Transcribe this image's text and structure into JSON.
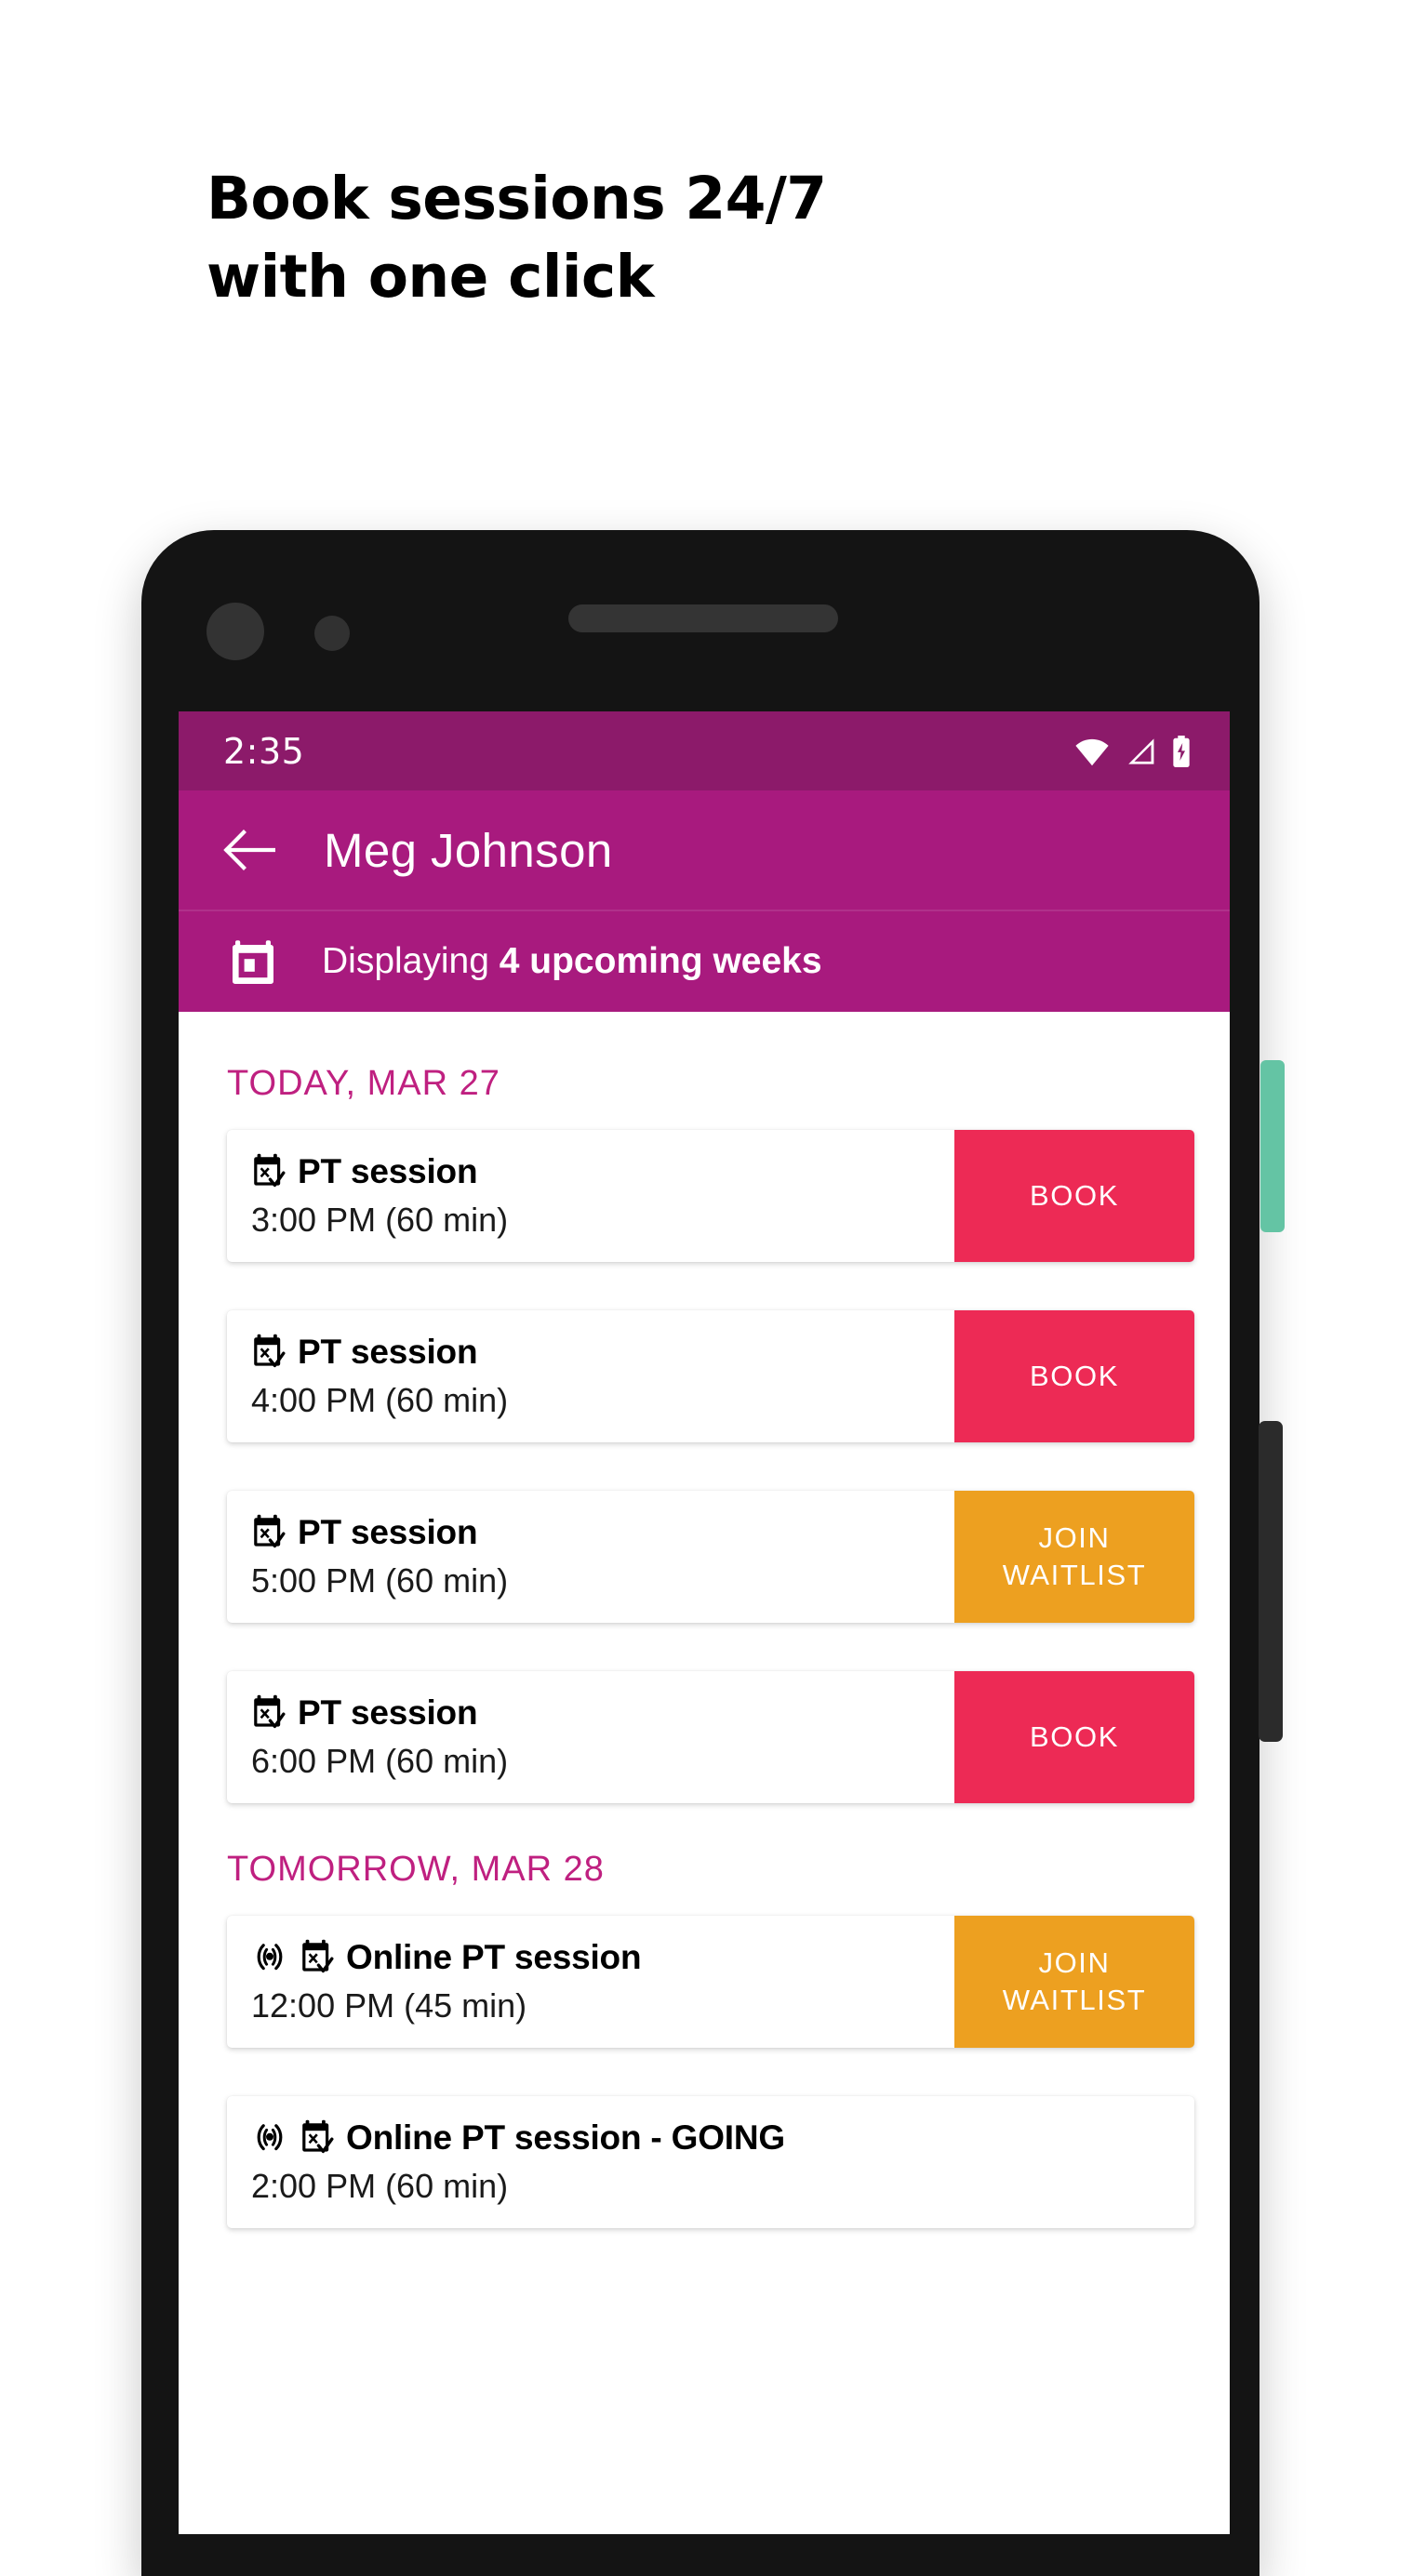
{
  "headline": "Book sessions 24/7\nwith one click",
  "colors": {
    "statusbar": "#8c1a6a",
    "appbar": "#a81a7e",
    "date_header": "#bf2080",
    "book_button": "#ed2a55",
    "waitlist_button": "#eda020",
    "side_button_teal": "#64c4a4",
    "phone_frame": "#141414"
  },
  "phone": {
    "camera_large": "camera-lens",
    "camera_small": "camera-lens-small",
    "speaker": "earpiece-speaker",
    "side_button_top": "volume-button",
    "side_button_bottom": "power-button"
  },
  "statusbar": {
    "time": "2:35",
    "icons": [
      "wifi-icon",
      "signal-icon",
      "battery-charging-icon"
    ]
  },
  "appbar": {
    "back_icon": "back-arrow-icon",
    "title": "Meg Johnson"
  },
  "displaybar": {
    "icon": "calendar-icon",
    "prefix": "Displaying ",
    "emphasis": "4 upcoming weeks"
  },
  "sections": [
    {
      "date_label": "TODAY, MAR 27",
      "sessions": [
        {
          "online": false,
          "title": "PT session",
          "time": "3:00 PM (60 min)",
          "action_label": "BOOK",
          "action_type": "book"
        },
        {
          "online": false,
          "title": "PT session",
          "time": "4:00 PM (60 min)",
          "action_label": "BOOK",
          "action_type": "book"
        },
        {
          "online": false,
          "title": "PT session",
          "time": "5:00 PM (60 min)",
          "action_label": "JOIN\nWAITLIST",
          "action_type": "waitlist"
        },
        {
          "online": false,
          "title": "PT session",
          "time": "6:00 PM (60 min)",
          "action_label": "BOOK",
          "action_type": "book"
        }
      ]
    },
    {
      "date_label": "TOMORROW, MAR 28",
      "sessions": [
        {
          "online": true,
          "title": "Online PT session",
          "time": "12:00 PM (45 min)",
          "action_label": "JOIN\nWAITLIST",
          "action_type": "waitlist"
        },
        {
          "online": true,
          "title": "Online PT session  - GOING",
          "time": "2:00 PM (60 min)",
          "action_label": "",
          "action_type": "none"
        }
      ]
    }
  ]
}
